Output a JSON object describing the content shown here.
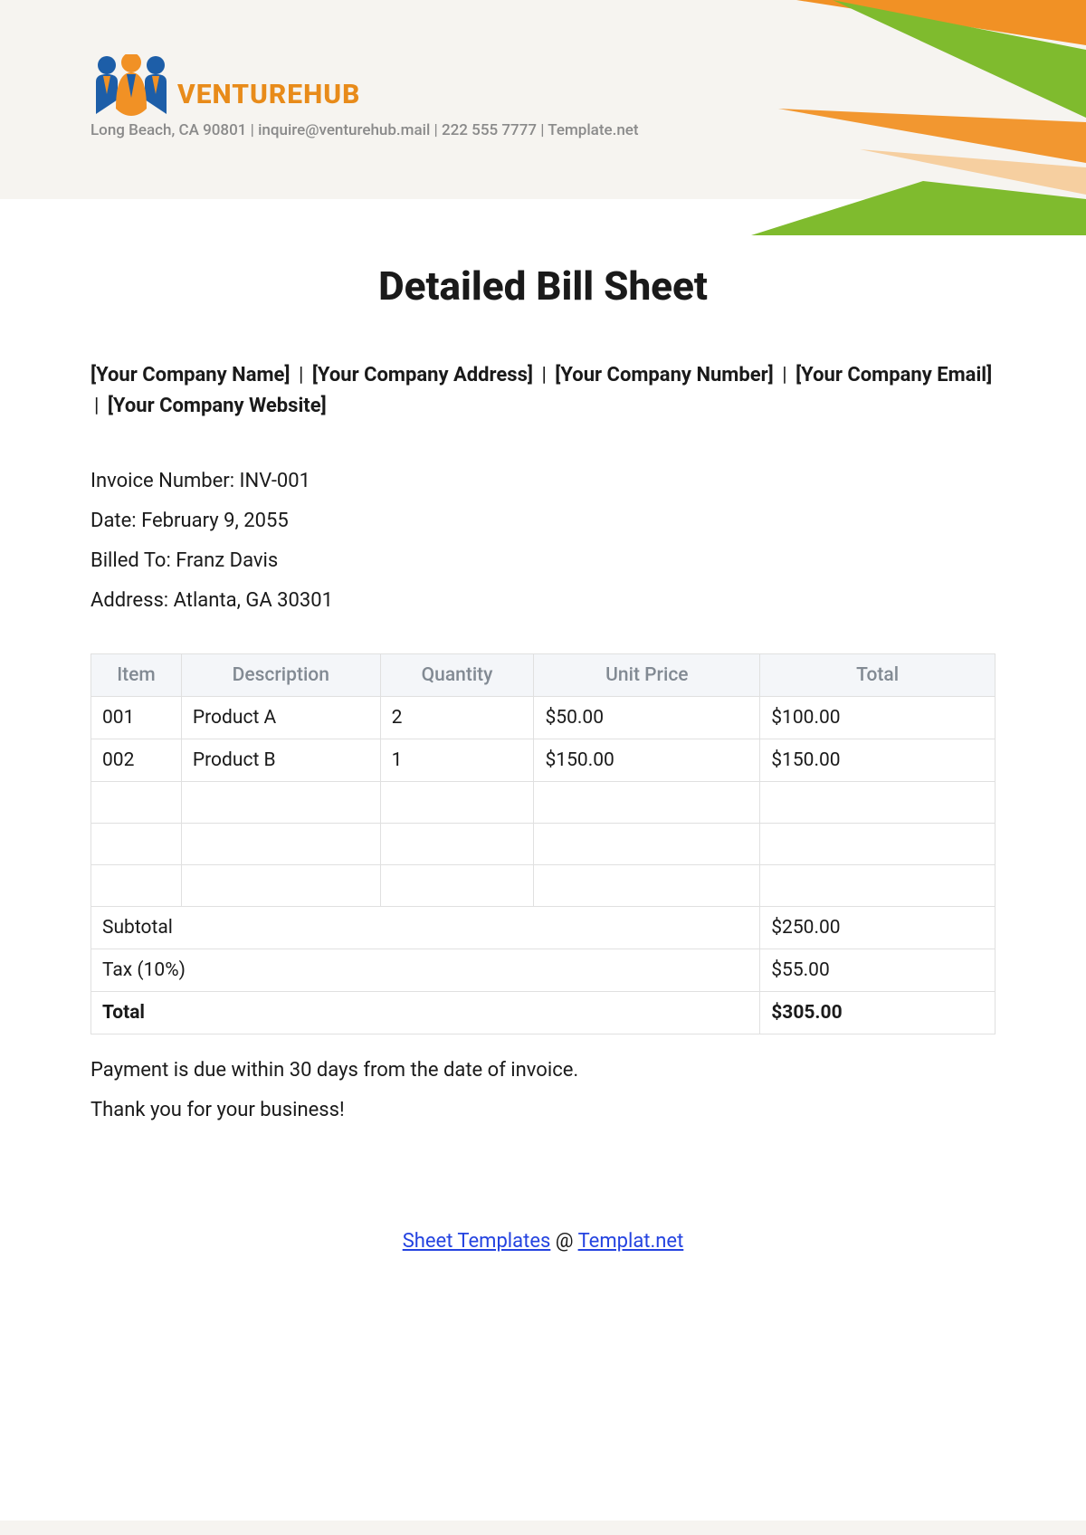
{
  "brand": {
    "name": "VENTUREHUB",
    "meta": "Long Beach, CA 90801 | inquire@venturehub.mail | 222 555 7777 | Template.net"
  },
  "title": "Detailed Bill Sheet",
  "placeholders": {
    "companyName": "[Your Company Name]",
    "companyAddress": "[Your Company Address]",
    "companyNumber": "[Your Company Number]",
    "companyEmail": "[Your Company Email]",
    "companyWebsite": "[Your Company Website]",
    "sep": "|"
  },
  "invoice": {
    "numberLabel": "Invoice Number: ",
    "numberValue": "INV-001",
    "dateLabel": "Date: ",
    "dateValue": "February 9, 2055",
    "billedToLabel": "Billed To: ",
    "billedToValue": "Franz Davis",
    "addressLabel": "Address: ",
    "addressValue": "Atlanta, GA 30301"
  },
  "table": {
    "headers": {
      "item": "Item",
      "description": "Description",
      "quantity": "Quantity",
      "unitPrice": "Unit Price",
      "total": "Total"
    },
    "rows": [
      {
        "item": "001",
        "description": "Product A",
        "quantity": "2",
        "unitPrice": "$50.00",
        "total": "$100.00"
      },
      {
        "item": "002",
        "description": "Product B",
        "quantity": "1",
        "unitPrice": "$150.00",
        "total": "$150.00"
      },
      {
        "item": "",
        "description": "",
        "quantity": "",
        "unitPrice": "",
        "total": ""
      },
      {
        "item": "",
        "description": "",
        "quantity": "",
        "unitPrice": "",
        "total": ""
      },
      {
        "item": "",
        "description": "",
        "quantity": "",
        "unitPrice": "",
        "total": ""
      }
    ],
    "summary": {
      "subtotalLabel": "Subtotal",
      "subtotalValue": "$250.00",
      "taxLabel": "Tax (10%)",
      "taxValue": "$55.00",
      "totalLabel": "Total",
      "totalValue": "$305.00"
    }
  },
  "notes": {
    "line1": "Payment is due within 30 days from the date of invoice.",
    "line2": "Thank you for your business!"
  },
  "footer": {
    "link1": "Sheet Templates",
    "sep": " @ ",
    "link2": "Templat.net"
  }
}
